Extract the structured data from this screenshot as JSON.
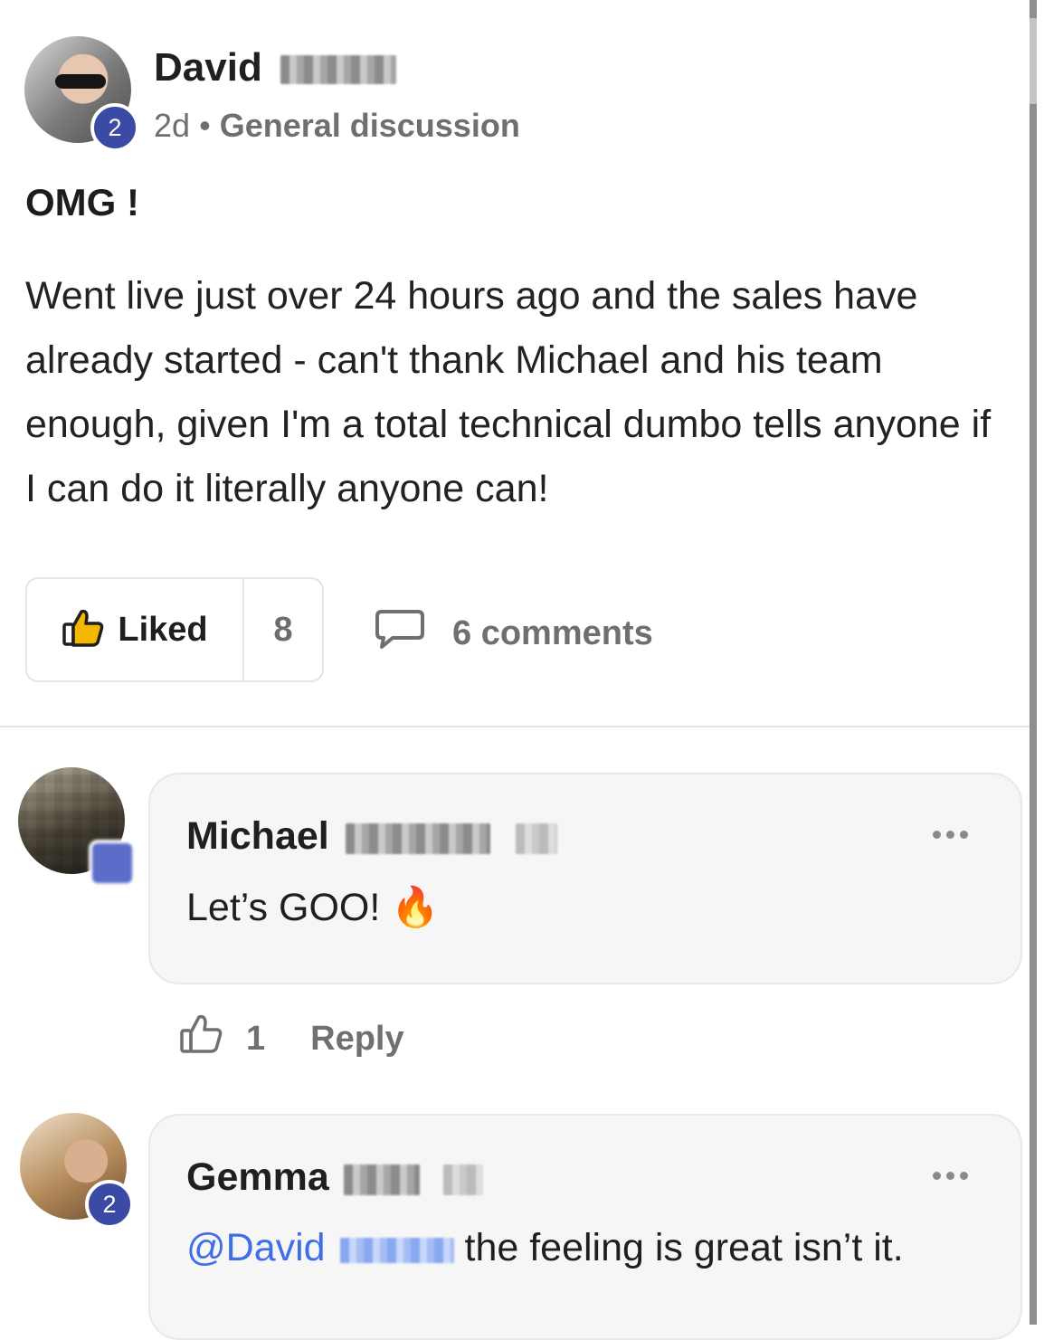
{
  "post": {
    "author_first_name": "David",
    "author_level": "2",
    "time_ago": "2d",
    "separator": "•",
    "category": "General discussion",
    "title": "OMG !",
    "body": "Went live just over 24 hours ago and the sales have already started - can't thank Michael and his team enough, given I'm a total technical dumbo tells anyone if I can do it literally anyone can!",
    "like_label": "Liked",
    "like_count": "8",
    "comments_label": "6 comments"
  },
  "comments": [
    {
      "author_first_name": "Michael",
      "text": "Let’s GOO!",
      "emoji": "🔥",
      "like_count": "1",
      "reply_label": "Reply"
    },
    {
      "author_first_name": "Gemma",
      "author_level": "2",
      "mention": "@David",
      "text": "the feeling is great isn’t it."
    }
  ],
  "colors": {
    "level_badge": "#3b4aa5",
    "mention": "#3f6ee8",
    "muted_text": "#6f6f6f"
  }
}
